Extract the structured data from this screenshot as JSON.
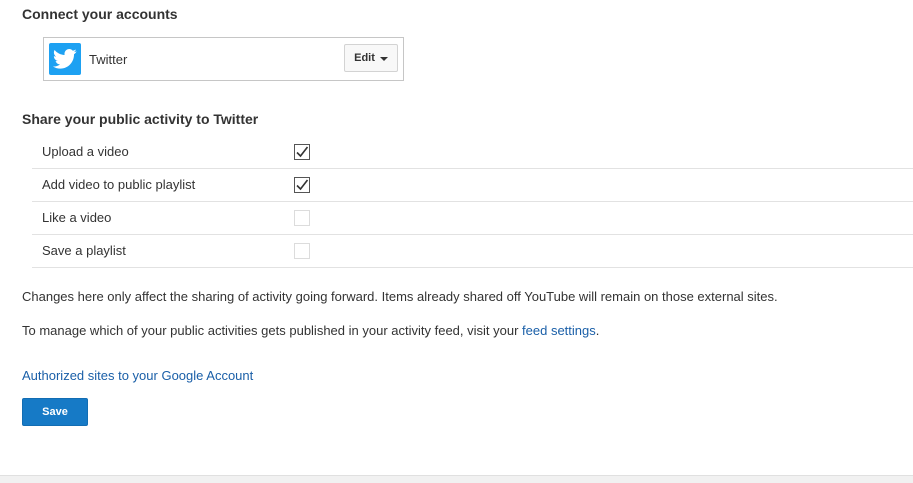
{
  "connect": {
    "title": "Connect your accounts",
    "account": {
      "name": "Twitter",
      "icon": "twitter-icon",
      "brand_color": "#1da1f2",
      "edit_label": "Edit"
    }
  },
  "share": {
    "title": "Share your public activity to Twitter",
    "items": [
      {
        "label": "Upload a video",
        "checked": true
      },
      {
        "label": "Add video to public playlist",
        "checked": true
      },
      {
        "label": "Like a video",
        "checked": false
      },
      {
        "label": "Save a playlist",
        "checked": false
      }
    ]
  },
  "info": {
    "changes": "Changes here only affect the sharing of activity going forward. Items already shared off YouTube will remain on those external sites.",
    "manage_prefix": "To manage which of your public activities gets published in your activity feed, visit your ",
    "manage_link": "feed settings",
    "manage_suffix": "."
  },
  "links": {
    "authorized": "Authorized sites to your Google Account"
  },
  "actions": {
    "save_label": "Save"
  },
  "colors": {
    "link": "#1a5fa8",
    "primary_button": "#167ac6"
  }
}
